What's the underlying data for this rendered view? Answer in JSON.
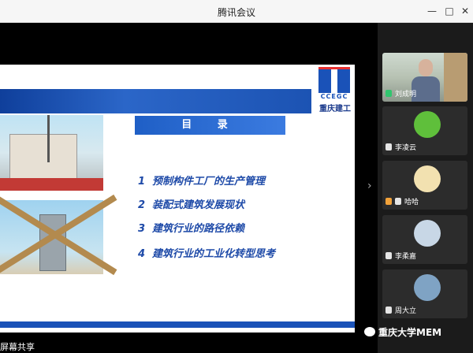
{
  "window": {
    "title": "腾讯会议"
  },
  "slide": {
    "menu_title": "目 录",
    "logo_text": "CCEGC",
    "logo_name": "重庆建工",
    "items": [
      {
        "num": "1",
        "text": "预制构件工厂的生产管理"
      },
      {
        "num": "2",
        "text": "装配式建筑发展现状"
      },
      {
        "num": "3",
        "text": "建筑行业的路径依赖"
      },
      {
        "num": "4",
        "text": "建筑行业的工业化转型思考"
      }
    ]
  },
  "participants": [
    {
      "name": "刘成明",
      "type": "video"
    },
    {
      "name": "李凌云",
      "type": "avatar",
      "avatar_color": "#5fbf3b"
    },
    {
      "name": "哈哈",
      "type": "avatar",
      "avatar_color": "#f2e1b0"
    },
    {
      "name": "李柔嘉",
      "type": "avatar",
      "avatar_color": "#c8d7e6"
    },
    {
      "name": "周大立",
      "type": "avatar",
      "avatar_color": "#7fa3c4"
    }
  ],
  "status": {
    "screen_share": "屏幕共享"
  },
  "watermark": {
    "text": "重庆大学MEM"
  },
  "colors": {
    "accent": "#1a52b8",
    "titlebar_bg": "#f6f6f6"
  }
}
